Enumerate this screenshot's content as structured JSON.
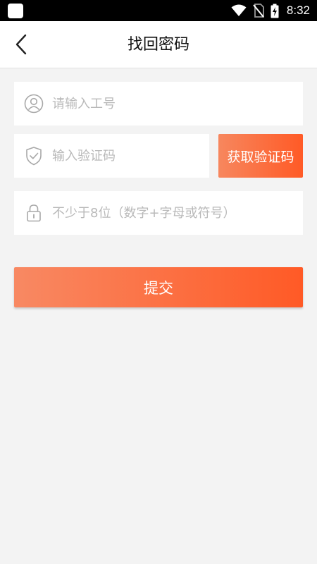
{
  "status_bar": {
    "time": "8:32",
    "icons": [
      "app-notification-icon",
      "wifi-icon",
      "no-sim-icon",
      "battery-charging-icon"
    ]
  },
  "header": {
    "title": "找回密码",
    "back_icon": "chevron-left-icon"
  },
  "form": {
    "employee_id": {
      "placeholder": "请输入工号",
      "value": "",
      "icon": "user-icon"
    },
    "verification_code": {
      "placeholder": "输入验证码",
      "value": "",
      "icon": "shield-check-icon"
    },
    "get_code_label": "获取验证码",
    "new_password": {
      "placeholder": "不少于8位（数字+字母或符号）",
      "value": "",
      "icon": "lock-icon"
    },
    "submit_label": "提交"
  },
  "colors": {
    "accent_start": "#f7875e",
    "accent_end": "#ff5a26",
    "background": "#f3f3f3",
    "placeholder": "#b9b9b9",
    "icon_gray": "#9a9a9a"
  }
}
